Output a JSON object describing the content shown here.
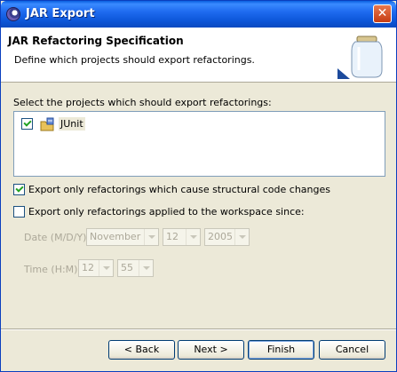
{
  "window": {
    "title": "JAR Export"
  },
  "header": {
    "title": "JAR Refactoring Specification",
    "description": "Define which projects should export refactorings."
  },
  "projects": {
    "label": "Select the projects which should export refactorings:",
    "items": [
      {
        "name": "JUnit",
        "checked": true
      }
    ]
  },
  "options": {
    "structural_label": "Export only refactorings which cause structural code changes",
    "structural_checked": true,
    "since_label": "Export only refactorings applied to the workspace since:",
    "since_checked": false
  },
  "date": {
    "label": "Date (M/D/Y):",
    "month": "November",
    "day": "12",
    "year": "2005"
  },
  "time": {
    "label": "Time (H:M):",
    "hour": "12",
    "minute": "55"
  },
  "buttons": {
    "back": "< Back",
    "next": "Next >",
    "finish": "Finish",
    "cancel": "Cancel"
  }
}
